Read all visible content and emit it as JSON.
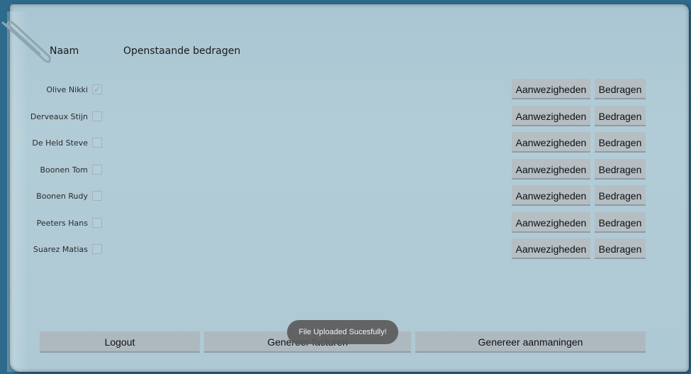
{
  "header": {
    "name_label": "Naam",
    "amount_label": "Openstaande bedragen"
  },
  "rows": [
    {
      "name": "Olive Nikki",
      "checked": true
    },
    {
      "name": "Derveaux Stijn",
      "checked": false
    },
    {
      "name": "De Held Steve",
      "checked": false
    },
    {
      "name": "Boonen Tom",
      "checked": false
    },
    {
      "name": "Boonen Rudy",
      "checked": false
    },
    {
      "name": "Peeters Hans",
      "checked": false
    },
    {
      "name": "Suarez Matias",
      "checked": false
    }
  ],
  "row_buttons": {
    "attendance_label": "Aanwezigheden",
    "amounts_label": "Bedragen"
  },
  "bottom": {
    "logout_label": "Logout",
    "invoices_label": "Genereer facturen",
    "reminders_label": "Genereer aanmaningen"
  },
  "toast": {
    "text": "File Uploaded Sucesfully!"
  },
  "icons": {
    "check": "check-icon",
    "clip": "paperclip-icon"
  }
}
